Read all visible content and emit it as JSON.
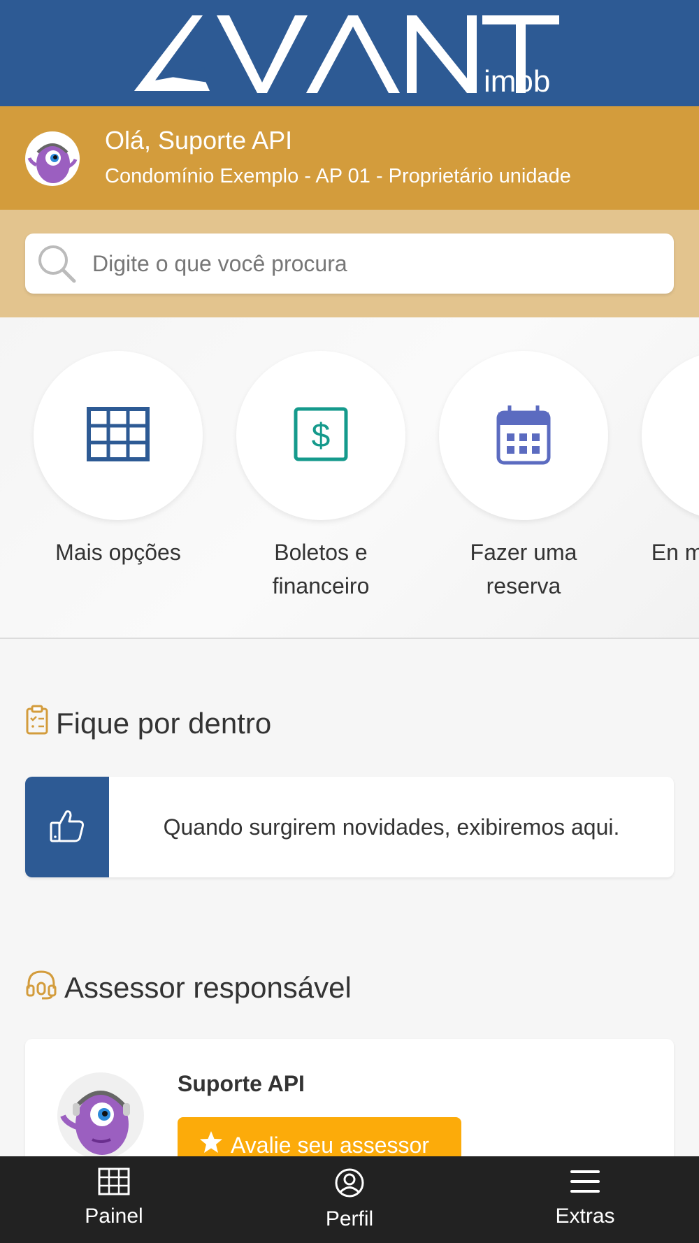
{
  "brand": {
    "logo_text": "AVANT",
    "logo_sub": "imob"
  },
  "user": {
    "greeting": "Olá, Suporte API",
    "context": "Condomínio Exemplo - AP 01 - Proprietário unidade"
  },
  "search": {
    "placeholder": "Digite o que você procura",
    "value": ""
  },
  "shortcuts": [
    {
      "label": "Mais opções",
      "icon": "grid-icon",
      "color": "#2d5a94"
    },
    {
      "label": "Boletos e financeiro",
      "icon": "dollar-icon",
      "color": "#159a8c"
    },
    {
      "label": "Fazer uma reserva",
      "icon": "calendar-icon",
      "color": "#5b6bc0"
    },
    {
      "label": "En me",
      "icon": "package-icon",
      "color": "#1d6b5a"
    }
  ],
  "news": {
    "title": "Fique por dentro",
    "empty_message": "Quando surgirem novidades, exibiremos aqui."
  },
  "advisor": {
    "title": "Assessor responsável",
    "name": "Suporte API",
    "rate_label": "Avalie seu assessor"
  },
  "bottom_nav": [
    {
      "label": "Painel",
      "icon": "grid-icon"
    },
    {
      "label": "Perfil",
      "icon": "user-circle-icon"
    },
    {
      "label": "Extras",
      "icon": "menu-icon"
    }
  ],
  "colors": {
    "primary": "#2d5a94",
    "accent": "#d39c3c",
    "accent_light": "#e3c48e",
    "rate_button": "#fcab0a",
    "nav_bg": "#222222"
  }
}
